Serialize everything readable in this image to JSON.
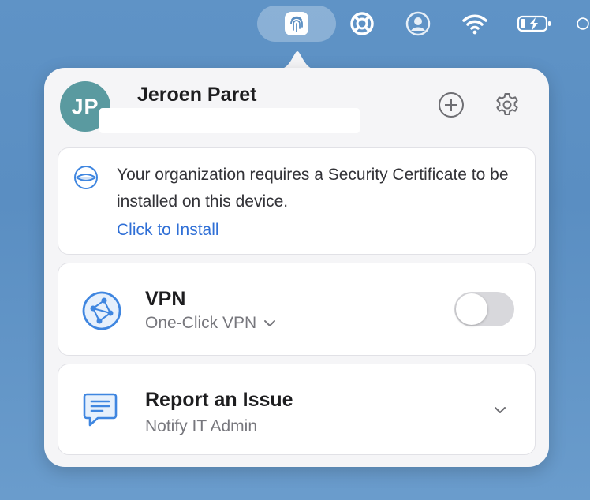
{
  "menubar": {
    "icons": [
      "fingerprint-icon",
      "lifebuoy-icon",
      "user-circle-icon",
      "wifi-icon",
      "battery-charging-icon",
      "clock-icon"
    ]
  },
  "user": {
    "initials": "JP",
    "name": "Jeroen Paret"
  },
  "header": {
    "add_icon": "plus-circle-icon",
    "settings_icon": "gear-icon"
  },
  "certificate": {
    "message": "Your organization requires a Security Certificate to be installed on this device.",
    "link": "Click to Install"
  },
  "vpn": {
    "title": "VPN",
    "mode": "One-Click VPN",
    "enabled": false
  },
  "report": {
    "title": "Report an Issue",
    "subtitle": "Notify IT Admin"
  },
  "colors": {
    "accent": "#2f6fd6",
    "icon_blue": "#3f86e0",
    "avatar": "#5a9aa0",
    "toggle_off": "#d8d8dc"
  }
}
